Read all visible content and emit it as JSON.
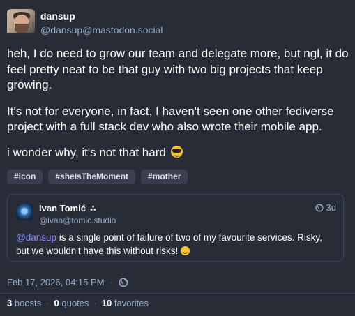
{
  "author": {
    "display_name": "dansup",
    "handle": "@dansup@mastodon.social"
  },
  "post": {
    "paragraph1": "heh, I do need to grow our team and delegate more, but ngl, it do feel pretty neat to be that guy with two big projects that keep growing.",
    "paragraph2": "It's not for everyone, in fact, I haven't seen one other fediverse project with a full stack dev who also wrote their mobile app.",
    "paragraph3": "i wonder why, it's not that hard",
    "paragraph3_emoji": "smiling-face-with-sunglasses"
  },
  "tags": [
    "#icon",
    "#sheIsTheMoment",
    "#mother"
  ],
  "quoted_post": {
    "display_name": "Ivan Tomić",
    "handle": "@ivan@tomic.studio",
    "time": "3d",
    "mention": "@dansup",
    "text": " is a single point of failure of two of my favourite services. Risky, but we wouldn't have this without risks! ",
    "emoji": "grinning-face"
  },
  "meta": {
    "timestamp": "Feb 17, 2026, 04:15 PM",
    "separator": "·",
    "visibility_icon": "globe-icon"
  },
  "stats": {
    "boosts_count": "3",
    "boosts_label": "boosts",
    "quotes_count": "0",
    "quotes_label": "quotes",
    "favorites_count": "10",
    "favorites_label": "favorites",
    "separator": "·"
  },
  "colors": {
    "background": "#282c37",
    "secondary_text": "#9baec8",
    "mention": "#8c8dff",
    "tag_bg": "#393f4f"
  }
}
